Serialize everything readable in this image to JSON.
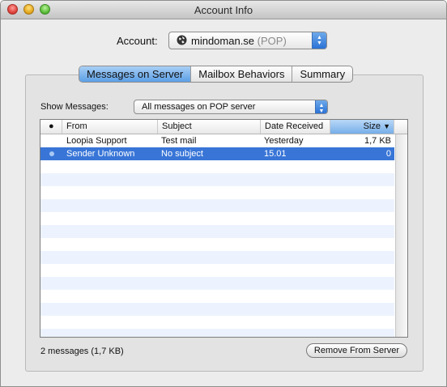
{
  "window": {
    "title": "Account Info"
  },
  "account": {
    "label": "Account:",
    "name": "mindoman.se",
    "type": "(POP)"
  },
  "tabs": [
    {
      "label": "Messages on Server",
      "active": true
    },
    {
      "label": "Mailbox Behaviors",
      "active": false
    },
    {
      "label": "Summary",
      "active": false
    }
  ],
  "filter": {
    "label": "Show Messages:",
    "value": "All messages on POP server"
  },
  "table": {
    "columns": {
      "status": "●",
      "from": "From",
      "subject": "Subject",
      "date": "Date Received",
      "size": "Size"
    },
    "sort_indicator": "▼",
    "rows": [
      {
        "from": "Loopia Support",
        "subject": "Test mail",
        "date": "Yesterday",
        "size": "1,7 KB",
        "selected": false
      },
      {
        "from": "Sender Unknown",
        "subject": "No subject",
        "date": "15.01",
        "size": "0",
        "selected": true
      }
    ]
  },
  "footer": {
    "count": "2 messages (1,7 KB)",
    "remove_label": "Remove From Server"
  },
  "colors": {
    "selection": "#3875d7",
    "stripe": "#edf3fe",
    "accent": "#5b9fe6"
  }
}
